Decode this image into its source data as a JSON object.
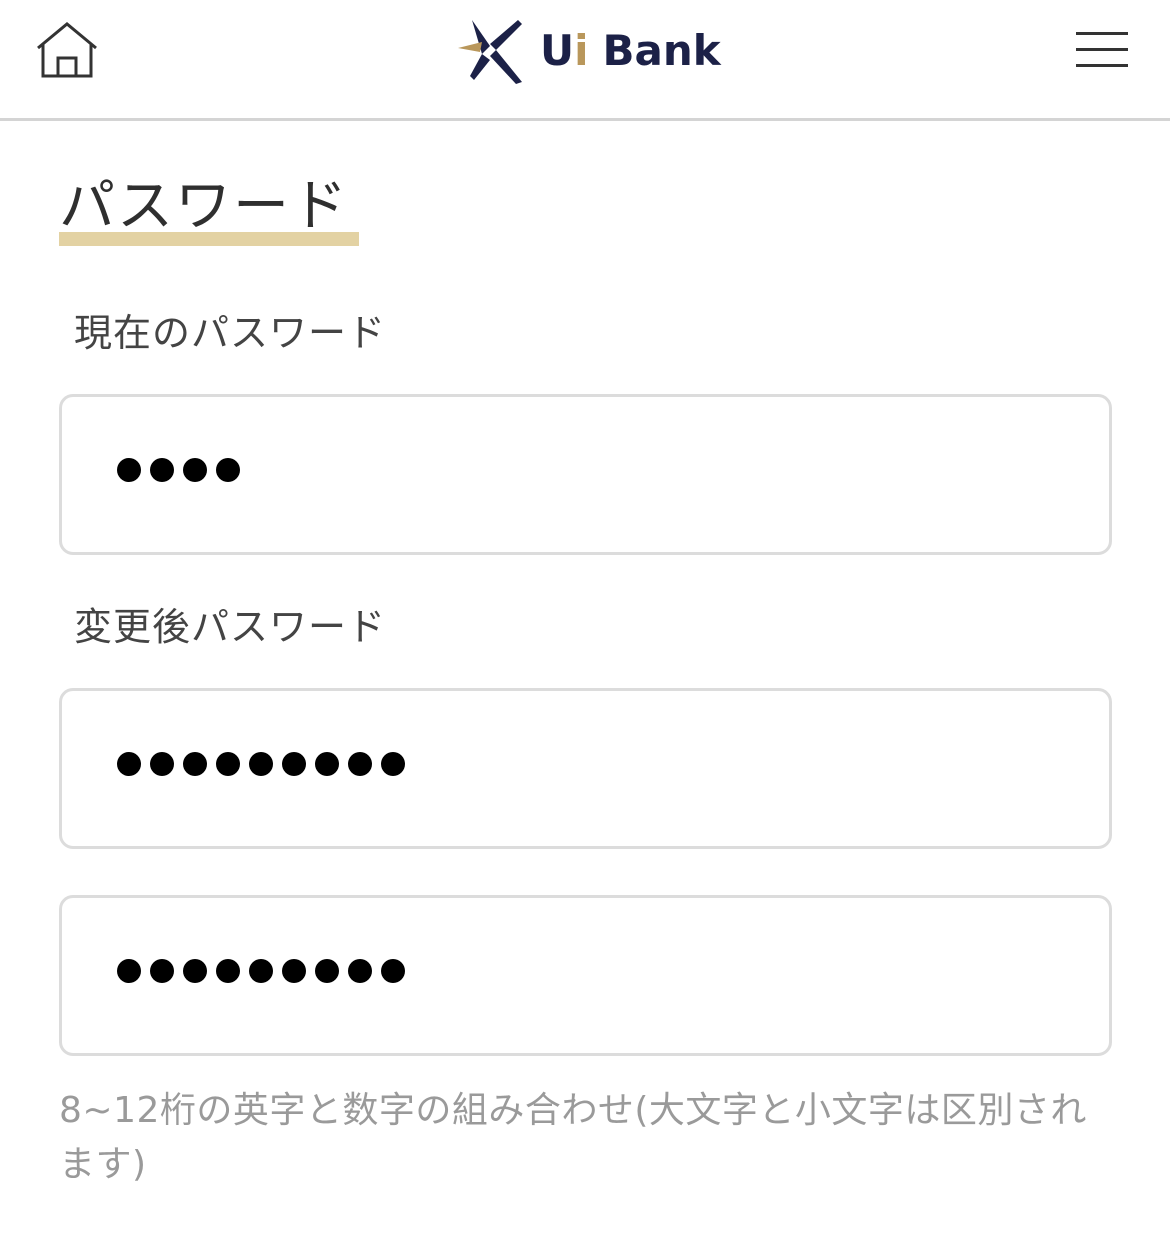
{
  "header": {
    "brand_u": "Ui",
    "brand_bank": "Bank",
    "home_icon": "home-icon",
    "menu_icon": "hamburger-menu-icon",
    "brand_colors": {
      "navy": "#1c2147",
      "gold": "#b9975b"
    }
  },
  "page": {
    "title": "パスワード",
    "accent_underline_color": "#e3d2a3"
  },
  "form": {
    "current_password": {
      "label": "現在のパスワード",
      "masked_length": 4
    },
    "new_password": {
      "label": "変更後パスワード",
      "masked_length": 9
    },
    "confirm_password": {
      "masked_length": 9
    },
    "hint": "8~12桁の英字と数字の組み合わせ(大文字と小文字は区別されます)"
  }
}
